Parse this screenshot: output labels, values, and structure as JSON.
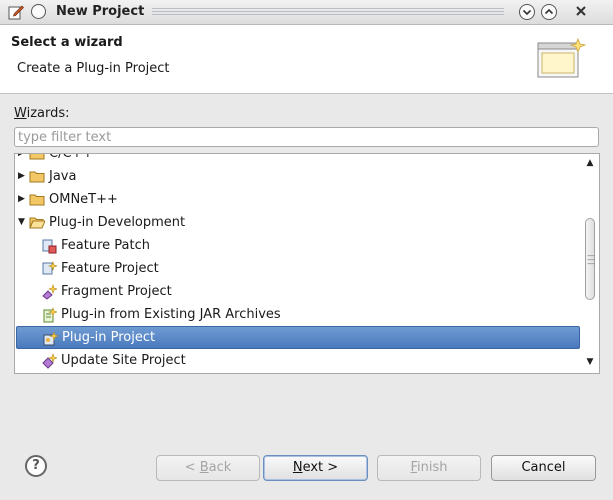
{
  "window": {
    "title": "New Project"
  },
  "header": {
    "title": "Select a wizard",
    "message": "Create a Plug-in Project"
  },
  "wizards_label": {
    "mnemonic": "W",
    "rest": "izards:"
  },
  "filter": {
    "placeholder": "type filter text",
    "value": ""
  },
  "tree": {
    "items": [
      {
        "label": "C/C++",
        "expanded": false,
        "partial": true
      },
      {
        "label": "Java",
        "expanded": false
      },
      {
        "label": "OMNeT++",
        "expanded": false
      },
      {
        "label": "Plug-in Development",
        "expanded": true
      }
    ],
    "children": [
      {
        "label": "Feature Patch",
        "icon": "feature-patch-icon"
      },
      {
        "label": "Feature Project",
        "icon": "feature-project-icon"
      },
      {
        "label": "Fragment Project",
        "icon": "fragment-project-icon"
      },
      {
        "label": "Plug-in from Existing JAR Archives",
        "icon": "jar-plugin-icon"
      },
      {
        "label": "Plug-in Project",
        "icon": "plugin-project-icon",
        "selected": true
      },
      {
        "label": "Update Site Project",
        "icon": "update-site-icon"
      }
    ]
  },
  "buttons": {
    "back": {
      "pre": "< ",
      "mnemonic": "B",
      "rest": "ack",
      "enabled": false
    },
    "next": {
      "mnemonic": "N",
      "rest": "ext >",
      "enabled": true
    },
    "finish": {
      "mnemonic": "F",
      "rest": "inish",
      "enabled": false
    },
    "cancel": {
      "label": "Cancel",
      "enabled": true
    },
    "help": "?"
  },
  "colors": {
    "selection": "#4a7abe",
    "folder": "#e8b34a"
  }
}
